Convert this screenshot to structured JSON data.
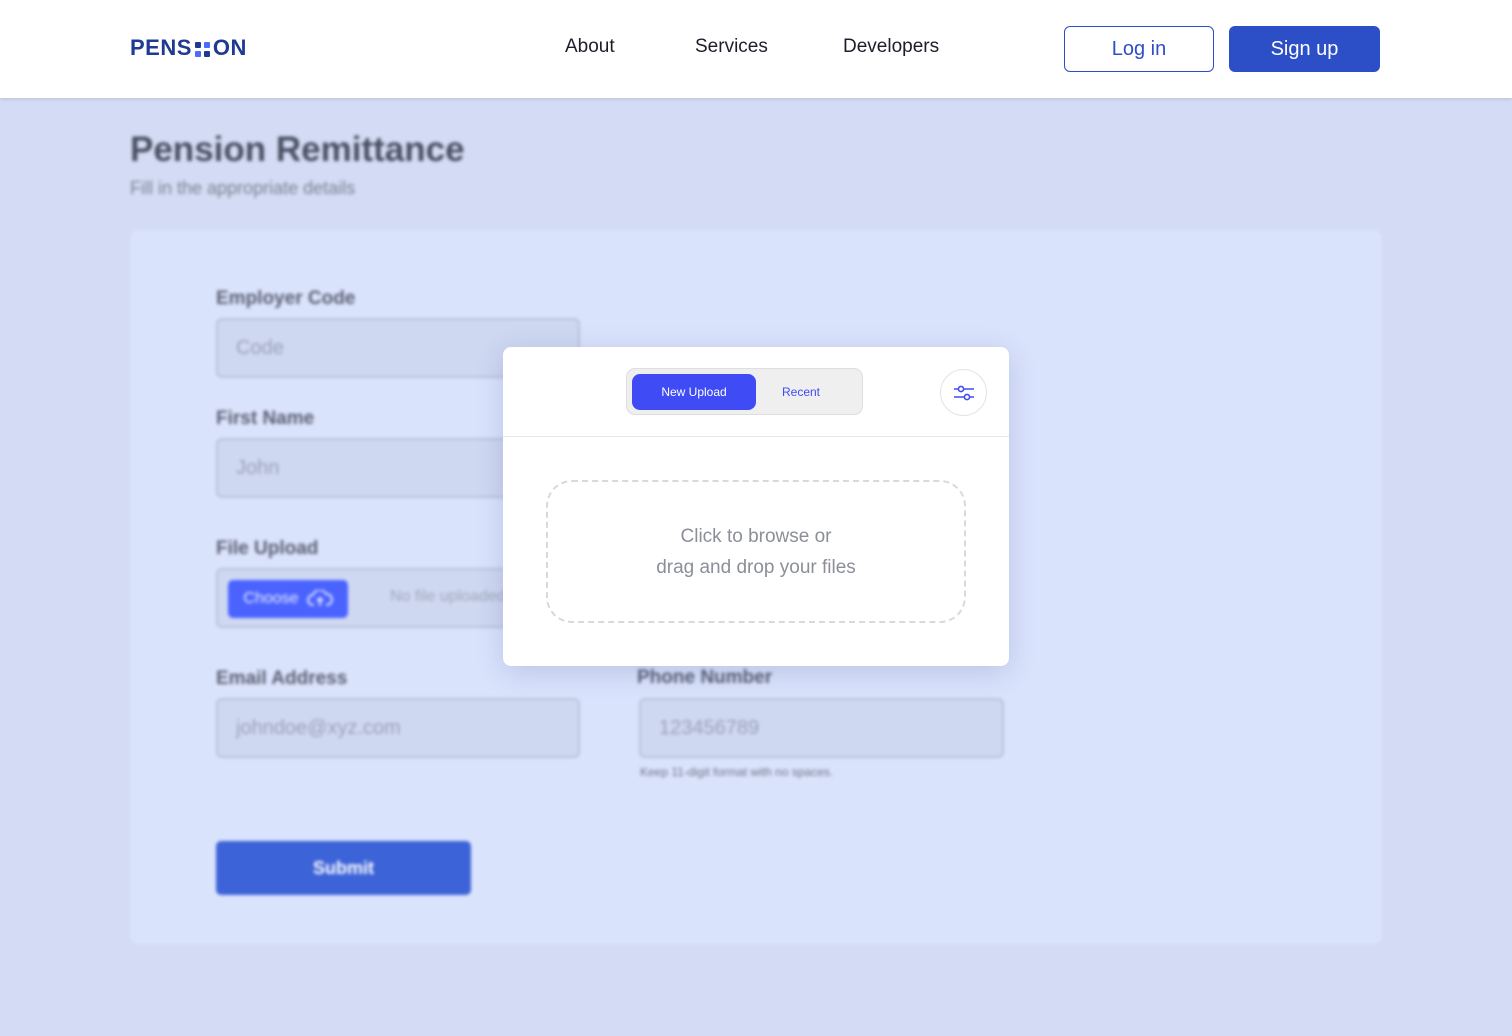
{
  "header": {
    "logo_left": "PENS",
    "logo_right": "ON",
    "nav": [
      "About",
      "Services",
      "Developers"
    ],
    "login_label": "Log in",
    "signup_label": "Sign up"
  },
  "page": {
    "title": "Pension Remittance",
    "subtitle": "Fill in the appropriate details"
  },
  "form": {
    "employer_code": {
      "label": "Employer Code",
      "placeholder": "Code"
    },
    "first_name": {
      "label": "First Name",
      "placeholder": "John"
    },
    "file_upload": {
      "label": "File Upload",
      "choose_label": "Choose",
      "status": "No file uploaded"
    },
    "email": {
      "label": "Email Address",
      "placeholder": "johndoe@xyz.com"
    },
    "phone": {
      "label": "Phone Number",
      "placeholder": "123456789",
      "hint": "Keep 11-digit format with no spaces."
    },
    "submit_label": "Submit"
  },
  "upload_modal": {
    "tabs": [
      "New Upload",
      "Recent"
    ],
    "active_tab": "New Upload",
    "dropzone_line1": "Click to browse or",
    "dropzone_line2": "drag and drop your files"
  },
  "colors": {
    "brand": "#1f3a93",
    "primary": "#2c4fc8",
    "accent": "#3f4cf5",
    "page_bg": "#d3dcf4"
  }
}
